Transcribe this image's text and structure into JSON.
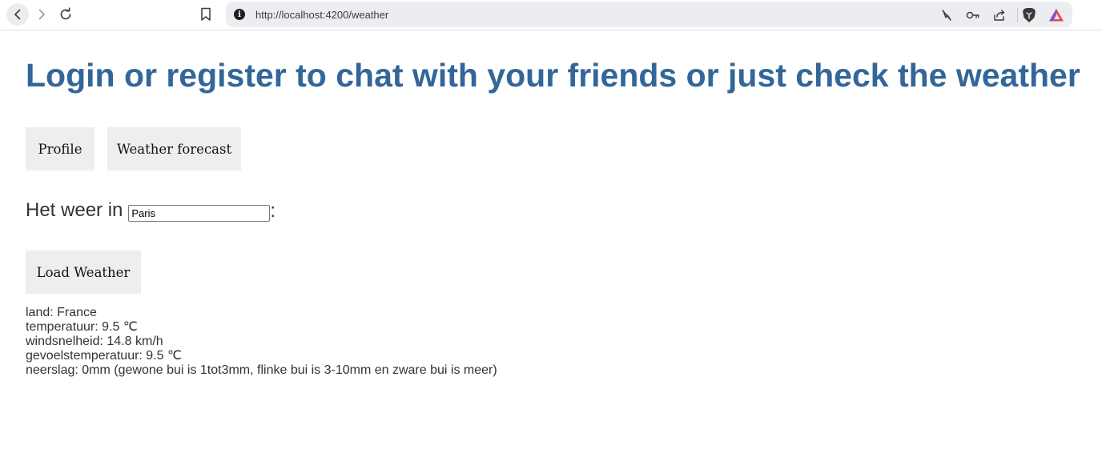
{
  "browser": {
    "url": "http://localhost:4200/weather"
  },
  "page": {
    "title": "Login or register to chat with your friends or just check the weather",
    "nav_buttons": {
      "profile": "Profile",
      "weather_forecast": "Weather forecast"
    },
    "weather_prompt": "Het weer in",
    "city_input": {
      "value": "Paris"
    },
    "colon": ":",
    "load_button": "Load Weather",
    "results": {
      "land": "land: France",
      "temperature": "temperatuur: 9.5 ℃",
      "wind": "windsnelheid: 14.8 km/h",
      "feels_like": "gevoelstemperatuur: 9.5 ℃",
      "precipitation": "neerslag: 0mm (gewone bui is 1tot3mm, flinke bui is 3-10mm en zware bui is meer)"
    }
  },
  "colors": {
    "title": "#336699",
    "button_bg": "#eeeeee",
    "text": "#333333"
  },
  "icons": {
    "back": "chevron-left-icon",
    "forward": "chevron-right-icon",
    "reload": "reload-icon",
    "bookmark": "bookmark-icon",
    "site_info": "info-icon",
    "tracking": "no-tracking-icon",
    "password": "key-icon",
    "share": "share-icon",
    "brave": "brave-shield-icon",
    "rewards": "brave-rewards-icon"
  }
}
